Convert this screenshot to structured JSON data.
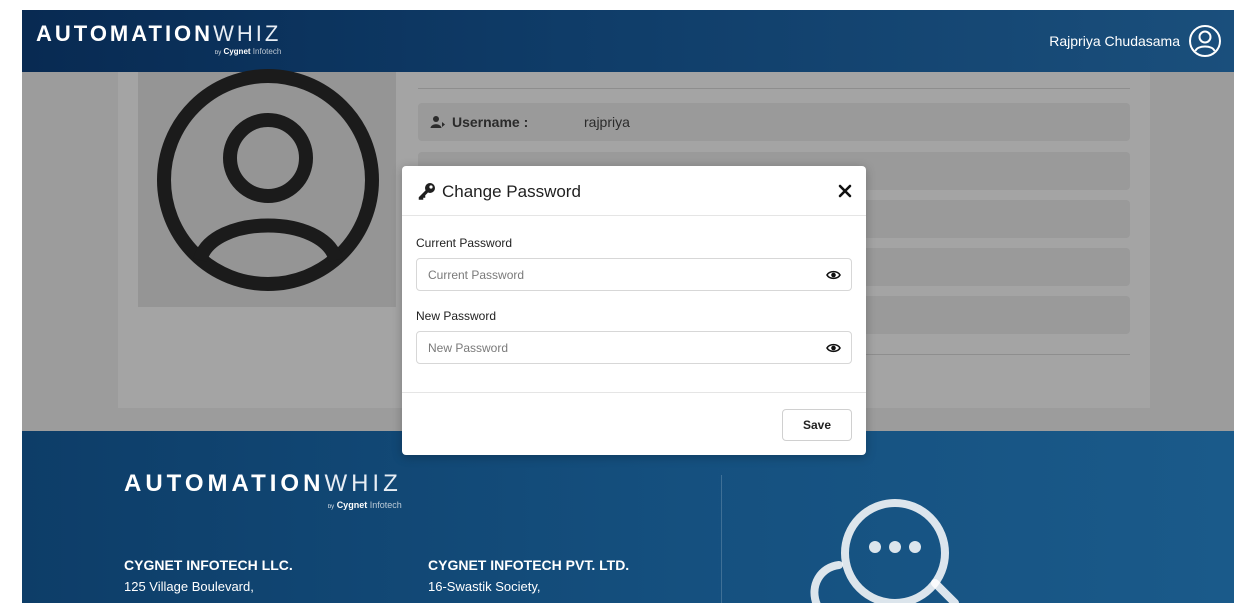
{
  "header": {
    "brand_bold": "AUTOMATION",
    "brand_light": "WHIZ",
    "brand_by": "by",
    "brand_company": "Cygnet",
    "brand_company_light": "Infotech",
    "user_name": "Rajpriya Chudasama",
    "avatar_icon": "user-circle-icon"
  },
  "profile": {
    "fields": [
      {
        "label": "Username :",
        "value": "rajpriya",
        "icon": "user-icon"
      },
      {
        "label": "",
        "value": "",
        "icon": "email-icon"
      },
      {
        "label": "",
        "value": ""
      },
      {
        "label": "",
        "value": ""
      },
      {
        "label": "",
        "value": ""
      }
    ]
  },
  "modal": {
    "title": "Change Password",
    "title_icon": "key-icon",
    "close_icon": "close-icon",
    "current_password": {
      "label": "Current Password",
      "placeholder": "Current Password",
      "value": ""
    },
    "new_password": {
      "label": "New Password",
      "placeholder": "New Password",
      "value": ""
    },
    "eye_icon": "eye-icon",
    "save_label": "Save"
  },
  "footer": {
    "brand_bold": "AUTOMATION",
    "brand_light": "WHIZ",
    "brand_by": "by",
    "brand_company": "Cygnet",
    "brand_company_light": "Infotech",
    "companies": [
      {
        "name": "CYGNET INFOTECH LLC.",
        "address": "125 Village Boulevard,"
      },
      {
        "name": "CYGNET INFOTECH PVT. LTD.",
        "address": "16-Swastik Society,"
      }
    ],
    "chat_icon": "chat-bubble-icon"
  },
  "colors": {
    "header_dark": "#082a52",
    "footer_blue": "#15507f",
    "overlay_gray": "#9c9c9c"
  }
}
